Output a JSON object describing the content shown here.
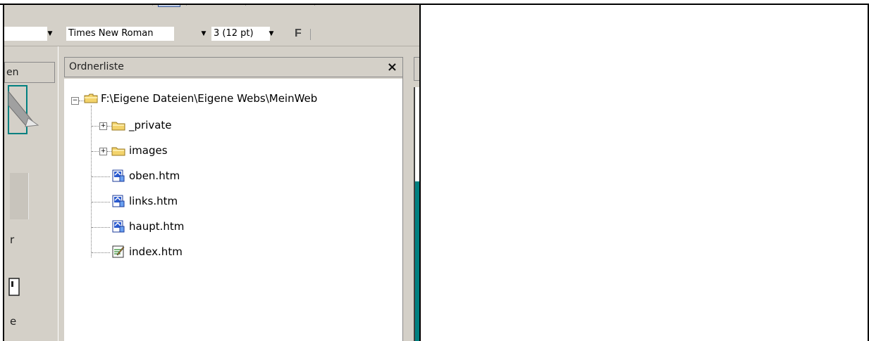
{
  "format_toolbar": {
    "font_name": "Times New Roman",
    "font_size": "3  (12 pt)",
    "bold_label": "F"
  },
  "left_panel": {
    "header_fragment": "en",
    "label_fragment_1": "r",
    "label_fragment_2": "e"
  },
  "folder_list": {
    "title": "Ordnerliste",
    "close_label": "×",
    "root": "F:\\Eigene Dateien\\Eigene Webs\\MeinWeb",
    "items": [
      {
        "label": "_private",
        "type": "folder"
      },
      {
        "label": "images",
        "type": "folder"
      },
      {
        "label": "oben.htm",
        "type": "page"
      },
      {
        "label": "links.htm",
        "type": "page"
      },
      {
        "label": "haupt.htm",
        "type": "page"
      },
      {
        "label": "index.htm",
        "type": "homepage"
      }
    ]
  },
  "colors": {
    "chrome": "#d4d0c8",
    "folder_yellow": "#f3d36b",
    "accent_teal": "#008080"
  }
}
